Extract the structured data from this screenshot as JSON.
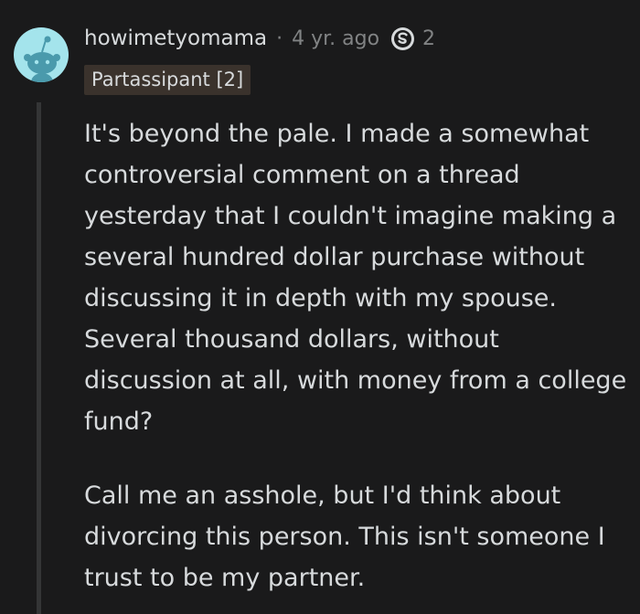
{
  "comment": {
    "username": "howimetyomama",
    "separator": "·",
    "timestamp": "4 yr. ago",
    "award": {
      "icon": "silver-award-icon",
      "count": "2"
    },
    "flair": "Partassipant [2]",
    "paragraphs": [
      "It's beyond the pale. I made a somewhat controversial comment on a thread yesterday that I couldn't imagine making a several hundred dollar purchase without discussing it in depth with my spouse. Several thousand dollars, without discussion at all, with money from a college fund?",
      "Call me an asshole, but I'd think about divorcing this person. This isn't someone I trust to be my partner."
    ]
  },
  "colors": {
    "background": "#1a1a1b",
    "text": "#d7dadc",
    "meta": "#818384",
    "avatar_bg": "#a4e4ec",
    "flair_bg": "#3a322c",
    "thread_line": "#343536"
  }
}
